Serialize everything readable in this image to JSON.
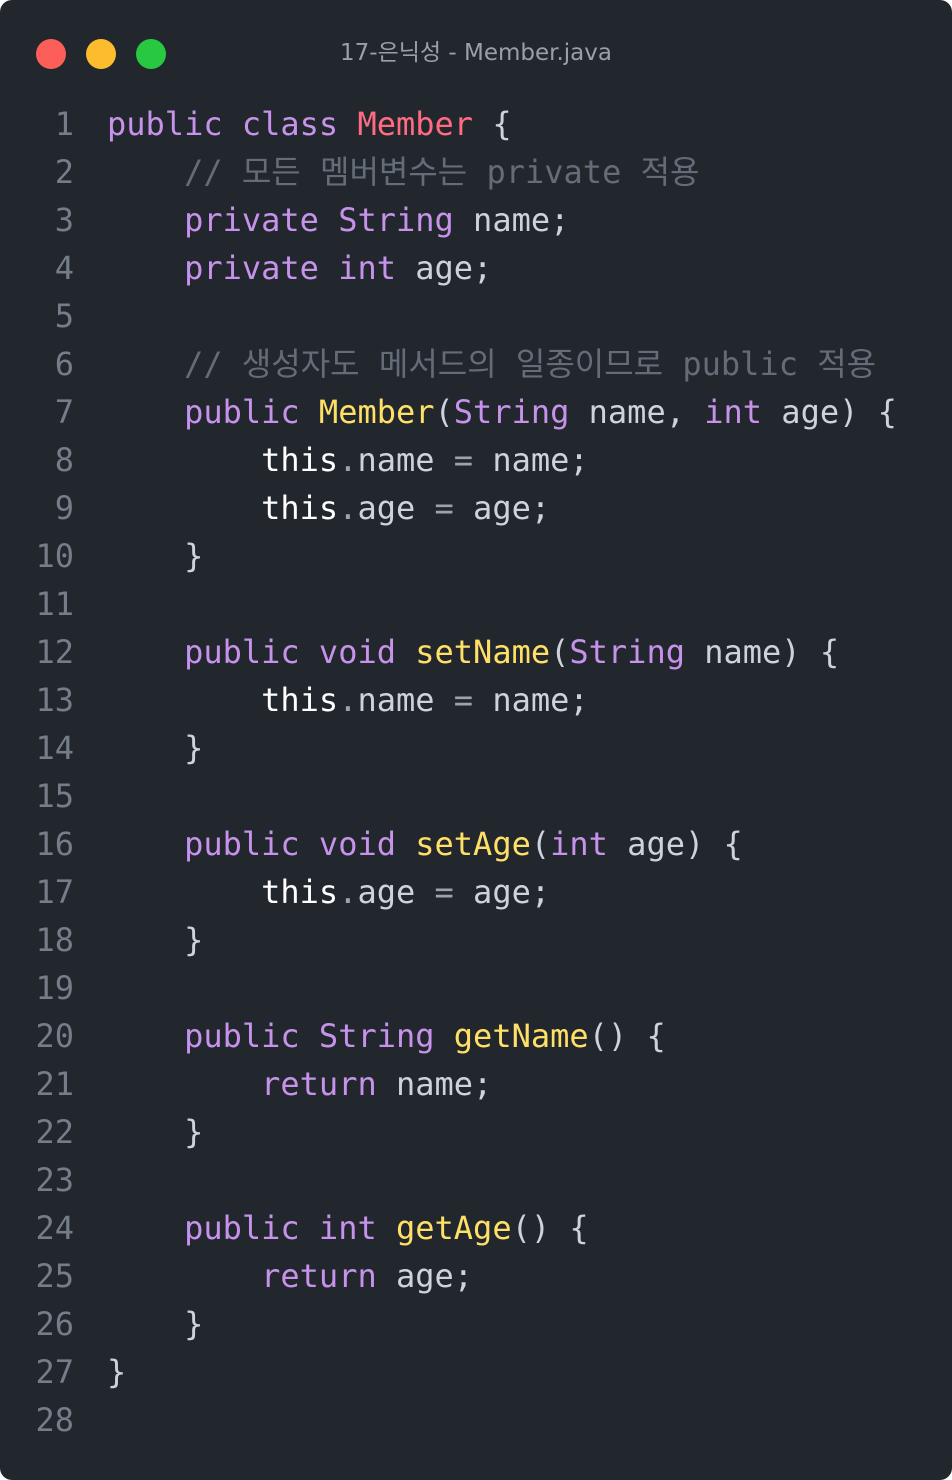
{
  "window": {
    "title": "17-은닉성 - Member.java"
  },
  "colors": {
    "background": "#22272e",
    "keyword": "#c792ea",
    "class_name": "#ff6b81",
    "function": "#ffe066",
    "comment": "#636c77",
    "this": "#ffffff",
    "text": "#cdd3dc",
    "line_number": "#757d88",
    "close_dot": "#fc5f57",
    "minimize_dot": "#fdbc2e",
    "maximize_dot": "#28c840"
  },
  "editor": {
    "lines": [
      {
        "n": "1",
        "tokens": [
          [
            "kw",
            "public"
          ],
          [
            "pn",
            " "
          ],
          [
            "kw",
            "class"
          ],
          [
            "pn",
            " "
          ],
          [
            "cls",
            "Member"
          ],
          [
            "pn",
            " {"
          ]
        ]
      },
      {
        "n": "2",
        "tokens": [
          [
            "pn",
            "    "
          ],
          [
            "cm",
            "// 모든 멤버변수는 private 적용"
          ]
        ]
      },
      {
        "n": "3",
        "tokens": [
          [
            "pn",
            "    "
          ],
          [
            "kw",
            "private"
          ],
          [
            "pn",
            " "
          ],
          [
            "kw",
            "String"
          ],
          [
            "pn",
            " "
          ],
          [
            "var",
            "name"
          ],
          [
            "pn",
            ";"
          ]
        ]
      },
      {
        "n": "4",
        "tokens": [
          [
            "pn",
            "    "
          ],
          [
            "kw",
            "private"
          ],
          [
            "pn",
            " "
          ],
          [
            "kw",
            "int"
          ],
          [
            "pn",
            " "
          ],
          [
            "var",
            "age"
          ],
          [
            "pn",
            ";"
          ]
        ]
      },
      {
        "n": "5",
        "tokens": []
      },
      {
        "n": "6",
        "tokens": [
          [
            "pn",
            "    "
          ],
          [
            "cm",
            "// 생성자도 메서드의 일종이므로 public 적용"
          ]
        ]
      },
      {
        "n": "7",
        "tokens": [
          [
            "pn",
            "    "
          ],
          [
            "kw",
            "public"
          ],
          [
            "pn",
            " "
          ],
          [
            "fn",
            "Member"
          ],
          [
            "pn",
            "("
          ],
          [
            "kw",
            "String"
          ],
          [
            "pn",
            " "
          ],
          [
            "var",
            "name"
          ],
          [
            "pn",
            ", "
          ],
          [
            "kw",
            "int"
          ],
          [
            "pn",
            " "
          ],
          [
            "var",
            "age"
          ],
          [
            "pn",
            ") {"
          ]
        ]
      },
      {
        "n": "8",
        "tokens": [
          [
            "pn",
            "        "
          ],
          [
            "th",
            "this"
          ],
          [
            "op",
            "."
          ],
          [
            "var",
            "name"
          ],
          [
            "op",
            " = "
          ],
          [
            "var",
            "name"
          ],
          [
            "pn",
            ";"
          ]
        ]
      },
      {
        "n": "9",
        "tokens": [
          [
            "pn",
            "        "
          ],
          [
            "th",
            "this"
          ],
          [
            "op",
            "."
          ],
          [
            "var",
            "age"
          ],
          [
            "op",
            " = "
          ],
          [
            "var",
            "age"
          ],
          [
            "pn",
            ";"
          ]
        ]
      },
      {
        "n": "10",
        "tokens": [
          [
            "pn",
            "    }"
          ]
        ]
      },
      {
        "n": "11",
        "tokens": []
      },
      {
        "n": "12",
        "tokens": [
          [
            "pn",
            "    "
          ],
          [
            "kw",
            "public"
          ],
          [
            "pn",
            " "
          ],
          [
            "kw",
            "void"
          ],
          [
            "pn",
            " "
          ],
          [
            "fn",
            "setName"
          ],
          [
            "pn",
            "("
          ],
          [
            "kw",
            "String"
          ],
          [
            "pn",
            " "
          ],
          [
            "var",
            "name"
          ],
          [
            "pn",
            ") {"
          ]
        ]
      },
      {
        "n": "13",
        "tokens": [
          [
            "pn",
            "        "
          ],
          [
            "th",
            "this"
          ],
          [
            "op",
            "."
          ],
          [
            "var",
            "name"
          ],
          [
            "op",
            " = "
          ],
          [
            "var",
            "name"
          ],
          [
            "pn",
            ";"
          ]
        ]
      },
      {
        "n": "14",
        "tokens": [
          [
            "pn",
            "    }"
          ]
        ]
      },
      {
        "n": "15",
        "tokens": []
      },
      {
        "n": "16",
        "tokens": [
          [
            "pn",
            "    "
          ],
          [
            "kw",
            "public"
          ],
          [
            "pn",
            " "
          ],
          [
            "kw",
            "void"
          ],
          [
            "pn",
            " "
          ],
          [
            "fn",
            "setAge"
          ],
          [
            "pn",
            "("
          ],
          [
            "kw",
            "int"
          ],
          [
            "pn",
            " "
          ],
          [
            "var",
            "age"
          ],
          [
            "pn",
            ") {"
          ]
        ]
      },
      {
        "n": "17",
        "tokens": [
          [
            "pn",
            "        "
          ],
          [
            "th",
            "this"
          ],
          [
            "op",
            "."
          ],
          [
            "var",
            "age"
          ],
          [
            "op",
            " = "
          ],
          [
            "var",
            "age"
          ],
          [
            "pn",
            ";"
          ]
        ]
      },
      {
        "n": "18",
        "tokens": [
          [
            "pn",
            "    }"
          ]
        ]
      },
      {
        "n": "19",
        "tokens": []
      },
      {
        "n": "20",
        "tokens": [
          [
            "pn",
            "    "
          ],
          [
            "kw",
            "public"
          ],
          [
            "pn",
            " "
          ],
          [
            "kw",
            "String"
          ],
          [
            "pn",
            " "
          ],
          [
            "fn",
            "getName"
          ],
          [
            "pn",
            "() {"
          ]
        ]
      },
      {
        "n": "21",
        "tokens": [
          [
            "pn",
            "        "
          ],
          [
            "kw",
            "return"
          ],
          [
            "pn",
            " "
          ],
          [
            "var",
            "name"
          ],
          [
            "pn",
            ";"
          ]
        ]
      },
      {
        "n": "22",
        "tokens": [
          [
            "pn",
            "    }"
          ]
        ]
      },
      {
        "n": "23",
        "tokens": []
      },
      {
        "n": "24",
        "tokens": [
          [
            "pn",
            "    "
          ],
          [
            "kw",
            "public"
          ],
          [
            "pn",
            " "
          ],
          [
            "kw",
            "int"
          ],
          [
            "pn",
            " "
          ],
          [
            "fn",
            "getAge"
          ],
          [
            "pn",
            "() {"
          ]
        ]
      },
      {
        "n": "25",
        "tokens": [
          [
            "pn",
            "        "
          ],
          [
            "kw",
            "return"
          ],
          [
            "pn",
            " "
          ],
          [
            "var",
            "age"
          ],
          [
            "pn",
            ";"
          ]
        ]
      },
      {
        "n": "26",
        "tokens": [
          [
            "pn",
            "    }"
          ]
        ]
      },
      {
        "n": "27",
        "tokens": [
          [
            "pn",
            "}"
          ]
        ]
      },
      {
        "n": "28",
        "tokens": []
      }
    ]
  }
}
